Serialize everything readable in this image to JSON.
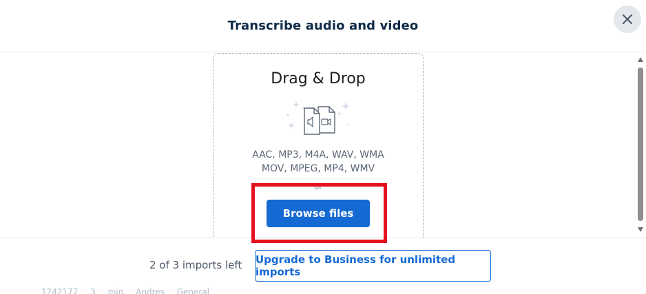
{
  "modal": {
    "title": "Transcribe audio and video",
    "close_icon": "close-icon"
  },
  "dropzone": {
    "title": "Drag & Drop",
    "icon": "audio-video-files-icon",
    "formats_line1": "AAC, MP3, M4A, WAV, WMA",
    "formats_line2": "MOV, MPEG, MP4, WMV",
    "or_text": "or",
    "browse_label": "Browse files"
  },
  "footer": {
    "imports_left": "2 of 3 imports left",
    "upgrade_label": "Upgrade to Business for unlimited imports"
  },
  "background_row": "1242177 3 min Andres General",
  "colors": {
    "primary": "#1469d2",
    "title": "#0e2a47",
    "highlight": "#e3121e"
  }
}
